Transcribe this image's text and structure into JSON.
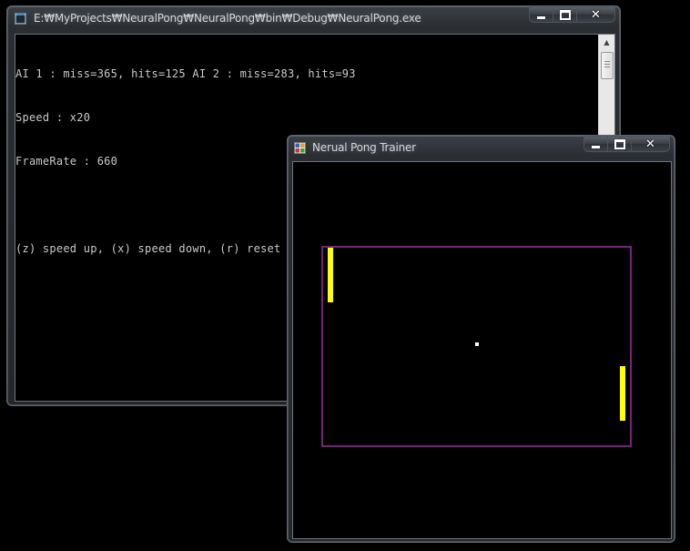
{
  "console_window": {
    "title": "E:₩MyProjects₩NeuralPong₩NeuralPong₩bin₩Debug₩NeuralPong.exe",
    "lines": [
      "AI 1 : miss=365, hits=125 AI 2 : miss=283, hits=93",
      "Speed : x20",
      "FrameRate : 660",
      "",
      "(z) speed up, (x) speed down, (r) reset ball position"
    ]
  },
  "pong_window": {
    "title": "Nerual Pong Trainer",
    "colors": {
      "court_border": "#7f1e7f",
      "paddle": "#ffff00",
      "ball": "#ffffff"
    }
  },
  "caption_buttons": {
    "minimize_icon": "minimize-icon",
    "maximize_icon": "maximize-icon",
    "close_icon": "close-icon",
    "close_glyph": "✕"
  }
}
